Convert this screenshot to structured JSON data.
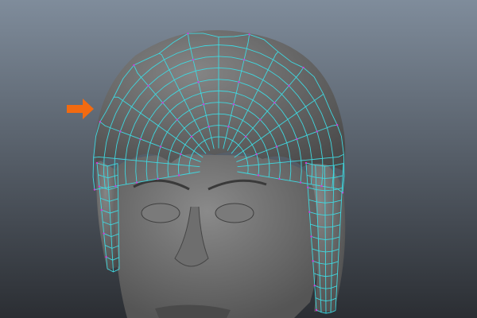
{
  "viewport": {
    "background_top": "#7f8c9b",
    "background_bottom": "#2b2e33",
    "mesh_color": "#6b6b6b",
    "wireframe_color": "#3fd8e0",
    "vertex_color": "#d23ad8",
    "arrow_color": "#f26a10"
  },
  "icons": {
    "annotation_arrow": "arrow-right-icon"
  }
}
